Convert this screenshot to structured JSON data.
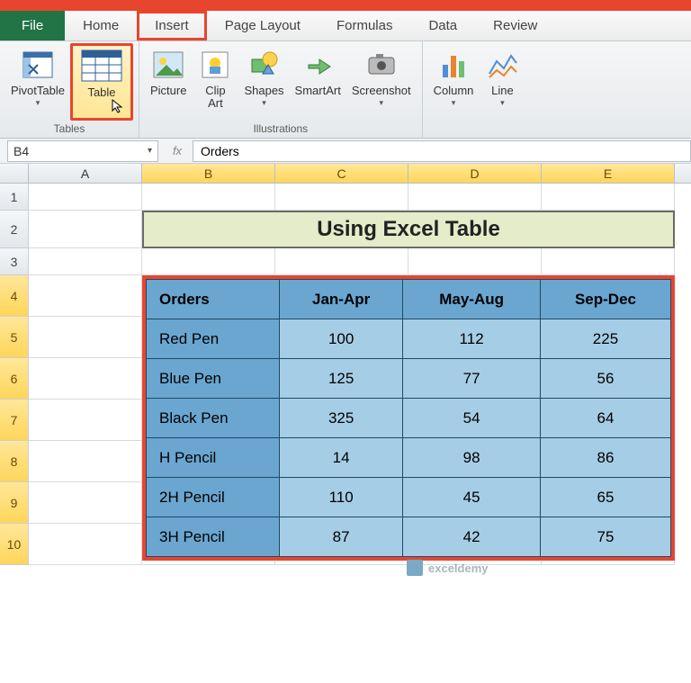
{
  "tabs": {
    "file": "File",
    "home": "Home",
    "insert": "Insert",
    "pagelayout": "Page Layout",
    "formulas": "Formulas",
    "data": "Data",
    "review": "Review"
  },
  "ribbon": {
    "groups": {
      "tables": "Tables",
      "illustrations": "Illustrations"
    },
    "items": {
      "pivot": "PivotTable",
      "table": "Table",
      "picture": "Picture",
      "clipart": "Clip\nArt",
      "shapes": "Shapes",
      "smartart": "SmartArt",
      "screenshot": "Screenshot",
      "column": "Column",
      "line": "Line"
    }
  },
  "namebox": "B4",
  "fx_label": "fx",
  "formula_value": "Orders",
  "cols": {
    "A": "A",
    "B": "B",
    "C": "C",
    "D": "D",
    "E": "E"
  },
  "rows": [
    "1",
    "2",
    "3",
    "4",
    "5",
    "6",
    "7",
    "8",
    "9",
    "10"
  ],
  "title": "Using Excel Table",
  "table": {
    "headers": [
      "Orders",
      "Jan-Apr",
      "May-Aug",
      "Sep-Dec"
    ],
    "rows": [
      [
        "Red Pen",
        "100",
        "112",
        "225"
      ],
      [
        "Blue Pen",
        "125",
        "77",
        "56"
      ],
      [
        "Black Pen",
        "325",
        "54",
        "64"
      ],
      [
        "H Pencil",
        "14",
        "98",
        "86"
      ],
      [
        "2H Pencil",
        "110",
        "45",
        "65"
      ],
      [
        "3H Pencil",
        "87",
        "42",
        "75"
      ]
    ]
  },
  "watermark": "exceldemy",
  "chart_data": {
    "type": "table",
    "title": "Using Excel Table",
    "columns": [
      "Orders",
      "Jan-Apr",
      "May-Aug",
      "Sep-Dec"
    ],
    "rows": [
      {
        "Orders": "Red Pen",
        "Jan-Apr": 100,
        "May-Aug": 112,
        "Sep-Dec": 225
      },
      {
        "Orders": "Blue Pen",
        "Jan-Apr": 125,
        "May-Aug": 77,
        "Sep-Dec": 56
      },
      {
        "Orders": "Black Pen",
        "Jan-Apr": 325,
        "May-Aug": 54,
        "Sep-Dec": 64
      },
      {
        "Orders": "H Pencil",
        "Jan-Apr": 14,
        "May-Aug": 98,
        "Sep-Dec": 86
      },
      {
        "Orders": "2H Pencil",
        "Jan-Apr": 110,
        "May-Aug": 45,
        "Sep-Dec": 65
      },
      {
        "Orders": "3H Pencil",
        "Jan-Apr": 87,
        "May-Aug": 42,
        "Sep-Dec": 75
      }
    ]
  }
}
